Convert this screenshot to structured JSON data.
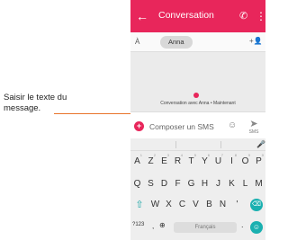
{
  "callout": {
    "text": "Saisir le texte du message."
  },
  "appbar": {
    "back_icon": "←",
    "title": "Conversation",
    "phone_icon": "✆",
    "more_icon": "⋮",
    "color": "#e8265b"
  },
  "recipient": {
    "label": "À",
    "chip": "Anna",
    "add_contact_icon": "+👤"
  },
  "conversation": {
    "info": "Conversation avec Anna • Maintenant"
  },
  "compose": {
    "attach_icon": "+",
    "placeholder": "Composer un SMS",
    "emoji_icon": "☺",
    "send_icon": "➤",
    "send_label": "SMS"
  },
  "keyboard": {
    "mic_icon": "🎤",
    "row1": [
      {
        "k": "A",
        "n": "1"
      },
      {
        "k": "Z",
        "n": "2"
      },
      {
        "k": "E",
        "n": "3"
      },
      {
        "k": "R",
        "n": "4"
      },
      {
        "k": "T",
        "n": "5"
      },
      {
        "k": "Y",
        "n": "6"
      },
      {
        "k": "U",
        "n": "7"
      },
      {
        "k": "I",
        "n": "8"
      },
      {
        "k": "O",
        "n": "9"
      },
      {
        "k": "P",
        "n": "0"
      }
    ],
    "row2": [
      "Q",
      "S",
      "D",
      "F",
      "G",
      "H",
      "J",
      "K",
      "L",
      "M"
    ],
    "row3": [
      "W",
      "X",
      "C",
      "V",
      "B",
      "N",
      "'"
    ],
    "shift_icon": "⇧",
    "delete_icon": "⌫",
    "row4": {
      "sym": "?123",
      "comma": ",",
      "globe": "⊕",
      "space": "Français",
      "period": ".",
      "emoji": "☺"
    }
  }
}
